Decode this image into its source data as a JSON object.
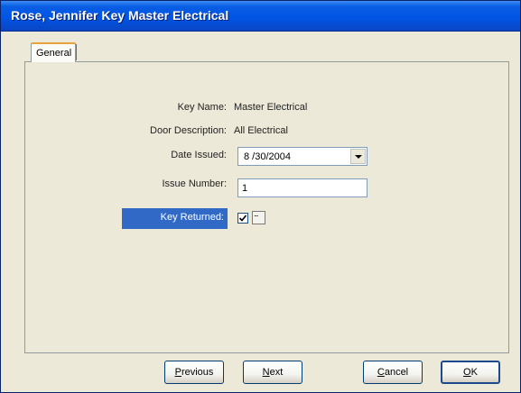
{
  "window": {
    "title": "Rose, Jennifer  Key Master Electrical"
  },
  "tabs": [
    {
      "label": "General"
    }
  ],
  "form": {
    "key_name_label": "Key Name:",
    "key_name_value": "Master Electrical",
    "door_description_label": "Door Description:",
    "door_description_value": "All Electrical",
    "date_issued_label": "Date Issued:",
    "date_issued_value": "8 /30/2004",
    "issue_number_label": "Issue Number:",
    "issue_number_value": "1",
    "key_returned_label": "Key Returned:",
    "key_returned_checked": true,
    "ellipsis_label": "..."
  },
  "buttons": {
    "previous": {
      "first": "P",
      "rest": "revious"
    },
    "next": {
      "first": "N",
      "rest": "ext"
    },
    "cancel": {
      "first": "C",
      "rest": "ancel"
    },
    "ok": {
      "first": "O",
      "rest": "K"
    }
  }
}
